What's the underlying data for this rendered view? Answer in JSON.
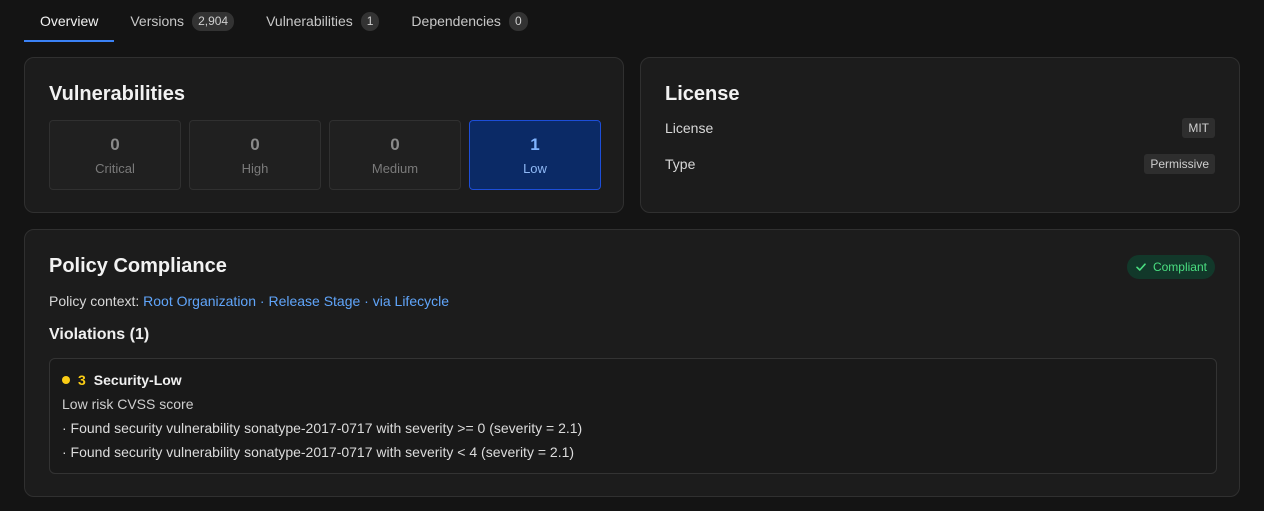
{
  "tabs": [
    {
      "label": "Overview",
      "badge": null
    },
    {
      "label": "Versions",
      "badge": "2,904"
    },
    {
      "label": "Vulnerabilities",
      "badge": "1"
    },
    {
      "label": "Dependencies",
      "badge": "0"
    }
  ],
  "vulnerabilities": {
    "title": "Vulnerabilities",
    "severities": [
      {
        "count": "0",
        "label": "Critical"
      },
      {
        "count": "0",
        "label": "High"
      },
      {
        "count": "0",
        "label": "Medium"
      },
      {
        "count": "1",
        "label": "Low"
      }
    ]
  },
  "license": {
    "title": "License",
    "rows": [
      {
        "key": "License",
        "value": "MIT"
      },
      {
        "key": "Type",
        "value": "Permissive"
      }
    ]
  },
  "policy": {
    "title": "Policy Compliance",
    "status": "Compliant",
    "context_label": "Policy context:",
    "context_org": "Root Organization",
    "context_sep1": " · ",
    "context_stage": "Release Stage",
    "context_sep2": " · ",
    "context_via": "via Lifecycle",
    "violations_title": "Violations (1)",
    "violation": {
      "threat": "3",
      "name": "Security-Low",
      "description": "Low risk CVSS score",
      "lines": [
        "· Found security vulnerability sonatype-2017-0717 with severity >= 0 (severity = 2.1)",
        "· Found security vulnerability sonatype-2017-0717 with severity < 4 (severity = 2.1)"
      ]
    }
  },
  "colors": {
    "accent": "#3b82f6",
    "low_active_bg": "#0b2a66",
    "compliant": "#4ade80",
    "threat_yellow": "#facc15",
    "link": "#60a5fa"
  }
}
